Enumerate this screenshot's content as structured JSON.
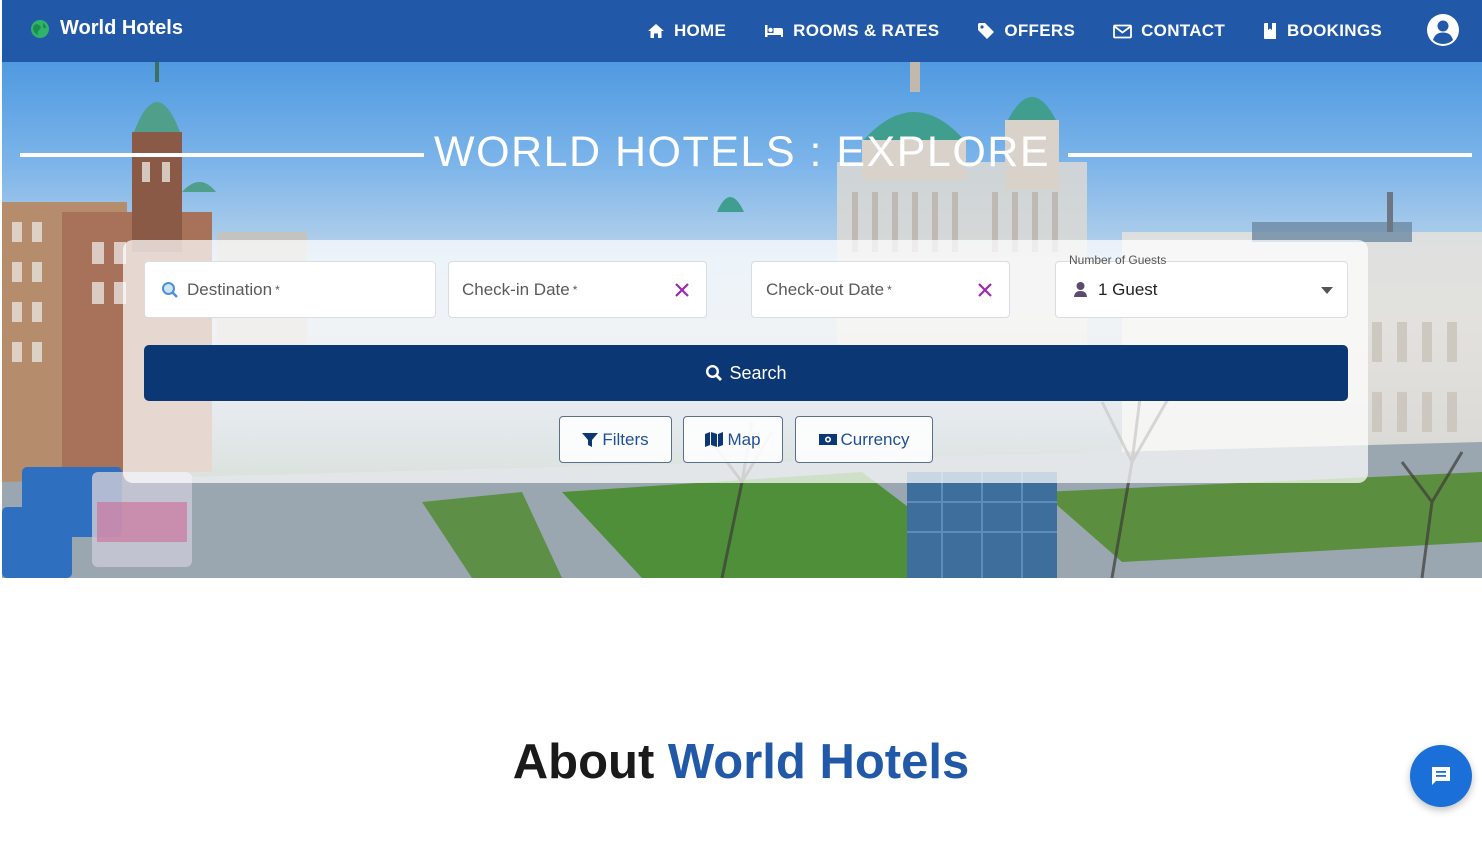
{
  "brand": {
    "name": "World Hotels",
    "icon": "globe-icon"
  },
  "nav": {
    "items": [
      {
        "label": "HOME",
        "icon": "home-icon"
      },
      {
        "label": "ROOMS & RATES",
        "icon": "bed-icon"
      },
      {
        "label": "OFFERS",
        "icon": "tag-icon"
      },
      {
        "label": "CONTACT",
        "icon": "mail-icon"
      },
      {
        "label": "BOOKINGS",
        "icon": "book-icon"
      }
    ],
    "account_icon": "account-circle-icon"
  },
  "hero": {
    "title": "WORLD HOTELS : EXPLORE"
  },
  "search": {
    "destination": {
      "placeholder": "Destination",
      "required_mark": "*"
    },
    "checkin": {
      "placeholder": "Check-in Date",
      "required_mark": "*"
    },
    "checkout": {
      "placeholder": "Check-out Date",
      "required_mark": "*"
    },
    "guests": {
      "label": "Number of Guests",
      "value": "1 Guest"
    },
    "button_label": "Search",
    "options": [
      {
        "label": "Filters",
        "icon": "filter-icon"
      },
      {
        "label": "Map",
        "icon": "map-icon"
      },
      {
        "label": "Currency",
        "icon": "money-icon"
      }
    ]
  },
  "about": {
    "prefix": "About",
    "highlight": "World Hotels"
  },
  "chat": {
    "icon": "chat-icon"
  },
  "colors": {
    "nav": "#2159a8",
    "search_button": "#0b3775",
    "accent": "#2159a8",
    "clear_icon": "#9c27b0"
  }
}
